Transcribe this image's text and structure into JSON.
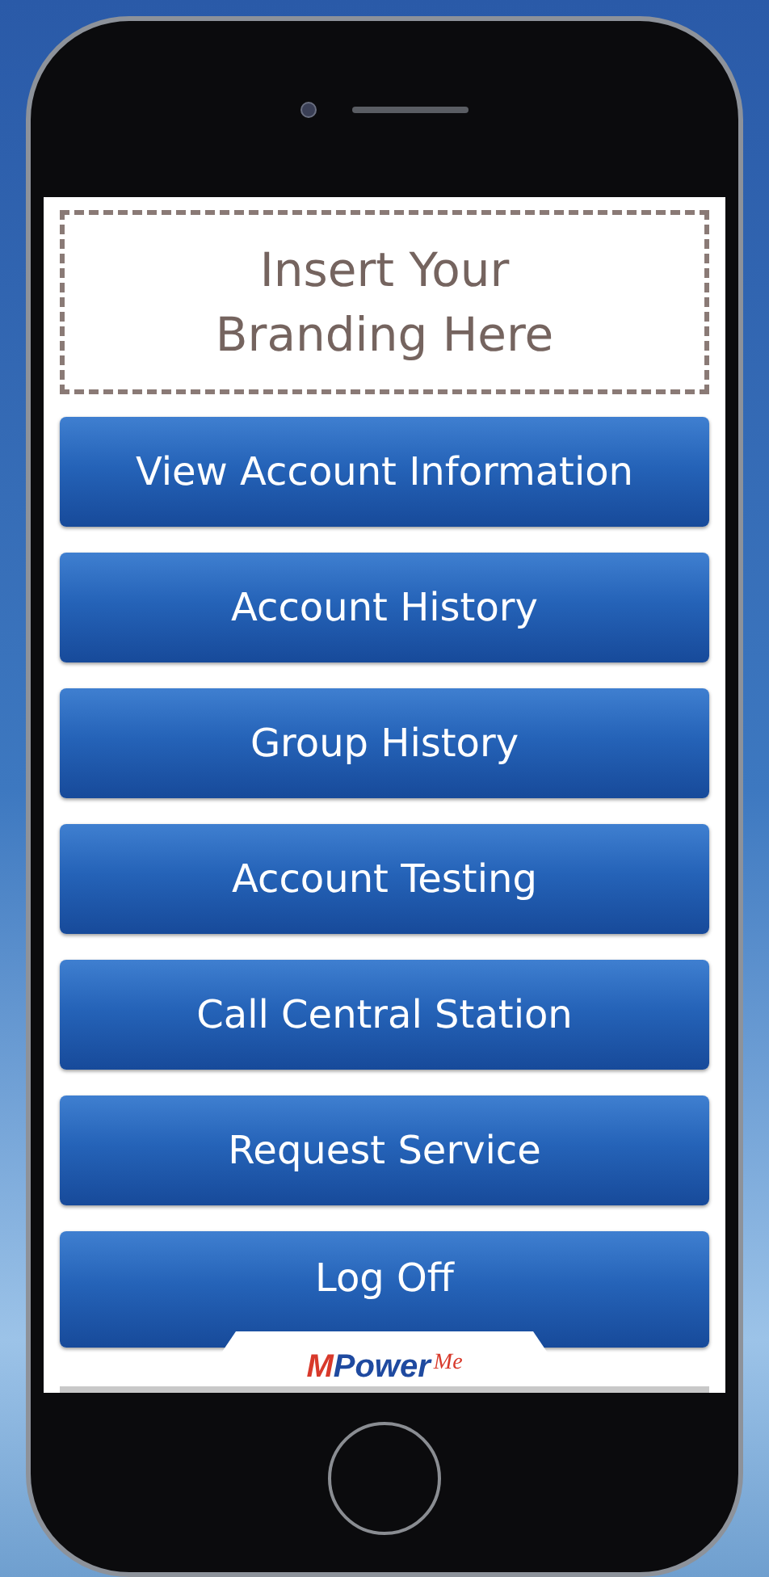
{
  "branding": {
    "placeholder_text": "Insert Your Branding Here"
  },
  "menu": [
    {
      "label": "View Account Information"
    },
    {
      "label": "Account History"
    },
    {
      "label": "Group History"
    },
    {
      "label": "Account Testing"
    },
    {
      "label": "Call Central Station"
    },
    {
      "label": "Request Service"
    },
    {
      "label": "Log Off"
    }
  ],
  "footer": {
    "logo": "MPower",
    "logo_suffix": "Me"
  }
}
